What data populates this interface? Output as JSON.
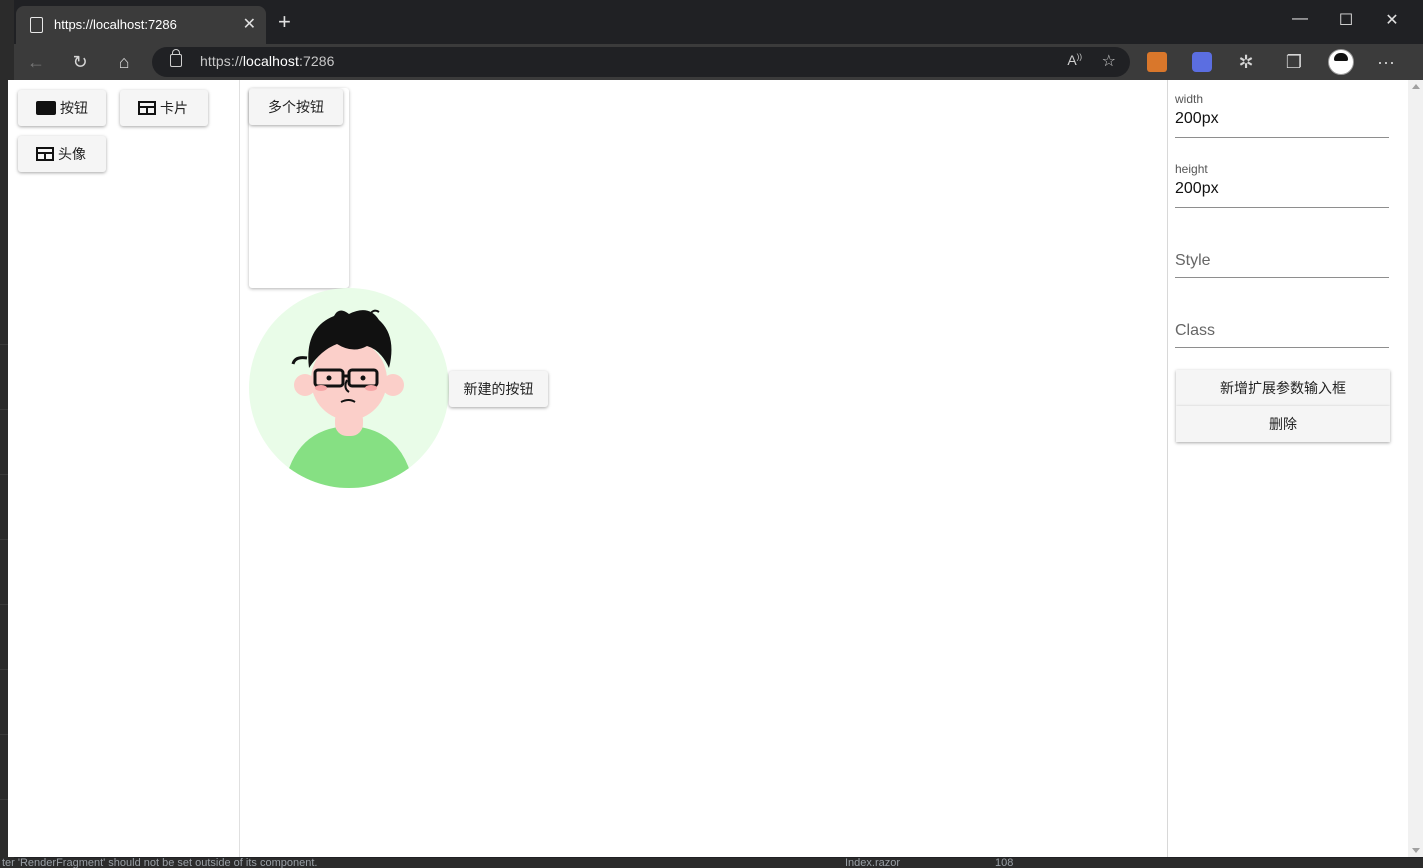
{
  "browser": {
    "tab_title": "https://localhost:7286",
    "url_scheme": "https://",
    "url_host": "localhost",
    "url_port": ":7286",
    "new_tab": "+",
    "win_min": "—",
    "win_max": "☐",
    "win_close": "✕",
    "tab_close": "✕",
    "more": "···"
  },
  "component_list": [
    {
      "label": "按钮",
      "icon": "square-icon"
    },
    {
      "label": "卡片",
      "icon": "card-icon"
    },
    {
      "label": "头像",
      "icon": "card-icon"
    }
  ],
  "canvas": {
    "multi_button": "多个按钮",
    "new_button": "新建的按钮"
  },
  "properties": {
    "width_label": "width",
    "width_value": "200px",
    "height_label": "height",
    "height_value": "200px",
    "style_placeholder": "Style",
    "class_placeholder": "Class",
    "add_param_button": "新增扩展参数输入框",
    "delete_button": "删除"
  },
  "status_bar": {
    "message": "ter 'RenderFragment' should not be set outside of its component.",
    "file": "Index.razor",
    "line": "108"
  },
  "colors": {
    "avatar_bg": "#e9fce8",
    "shirt": "#86e083",
    "skin": "#fbcfc9"
  }
}
